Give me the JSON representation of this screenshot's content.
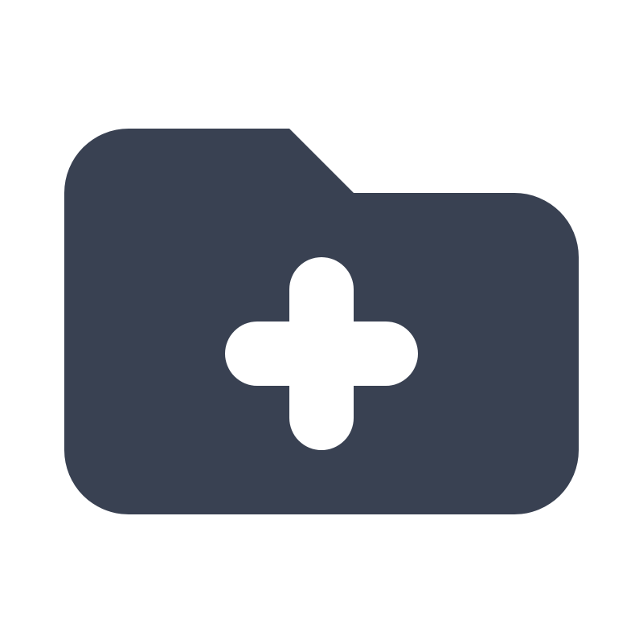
{
  "icon": {
    "name": "folder-add-icon",
    "fill_color": "#394152",
    "glyph_color": "#ffffff",
    "background_color": "#ffffff"
  }
}
